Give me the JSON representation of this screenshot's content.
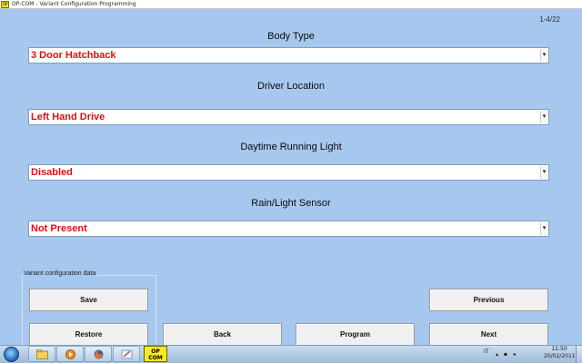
{
  "window": {
    "title": "OP-COM - Variant Configuration Programming",
    "app_icon_text": "OP",
    "page_counter": "1-4/22"
  },
  "fields": [
    {
      "label": "Body Type",
      "value": "3 Door Hatchback"
    },
    {
      "label": "Driver Location",
      "value": "Left Hand Drive"
    },
    {
      "label": "Daytime Running Light",
      "value": "Disabled"
    },
    {
      "label": "Rain/Light Sensor",
      "value": "Not Present"
    }
  ],
  "dropdown_arrow": "▾",
  "groupbox": {
    "legend": "Variant configuration data"
  },
  "buttons": {
    "save": "Save",
    "restore": "Restore",
    "back": "Back",
    "program": "Program",
    "previous": "Previous",
    "next": "Next"
  },
  "taskbar": {
    "opcom_line1": "OP",
    "opcom_line2": "COM",
    "language": "IT",
    "tray_icons": "▴ ▪ ◂",
    "time": "12:50",
    "date": "20/02/2011"
  },
  "colors": {
    "background": "#a7c8ee",
    "value_text": "#e11010",
    "opcom_yellow": "#f4ea1d"
  }
}
